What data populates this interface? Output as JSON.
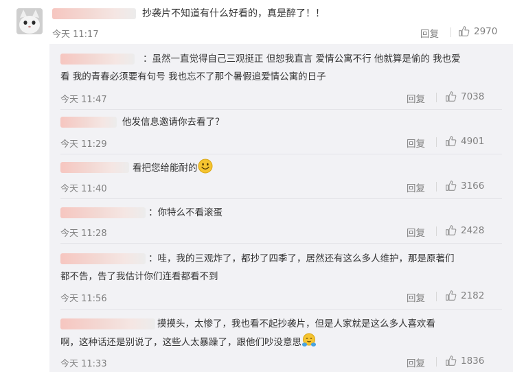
{
  "main_comment": {
    "text": "抄袭片不知道有什么好看的，真是醉了！！",
    "time": "今天 11:17",
    "reply_label": "回复",
    "likes": "2970"
  },
  "sub_comments": [
    {
      "line1": "：虽然一直觉得自己三观挺正  但恕我直言  爱情公寓不行  他就算是偷的  我也爱",
      "line2": "看  我的青春必须要有句号  我也忘不了那个暑假追爱情公寓的日子",
      "time": "今天 11:47",
      "reply_label": "回复",
      "likes": "7038"
    },
    {
      "line1": "他发信息邀请你去看了？",
      "time": "今天 11:29",
      "reply_label": "回复",
      "likes": "4901"
    },
    {
      "line1": "看把您给能耐的",
      "time": "今天 11:40",
      "reply_label": "回复",
      "likes": "3166"
    },
    {
      "line1": "：你特么不看滚蛋",
      "time": "今天 11:28",
      "reply_label": "回复",
      "likes": "2428"
    },
    {
      "line1": "：哇，我的三观炸了，都抄了四季了，居然还有这么多人维护，那是原著们",
      "line2": "都不告，告了我估计你们连看都看不到",
      "time": "今天 11:56",
      "reply_label": "回复",
      "likes": "2182"
    },
    {
      "line1": "摸摸头，太惨了，我也看不起抄袭片，但是人家就是这么多人喜欢看",
      "line2": "啊，这种话还是别说了，这些人太暴躁了，跟他们吵没意思",
      "time": "今天 11:33",
      "reply_label": "回复",
      "likes": "1836"
    }
  ],
  "icons": {
    "like": "thumbs-up-icon",
    "smile": "smile-emoji",
    "hug": "hug-emoji"
  },
  "colors": {
    "text": "#333333",
    "meta": "#808080",
    "sub_bg": "#f2f2f5",
    "emoji": "#f5c430"
  }
}
